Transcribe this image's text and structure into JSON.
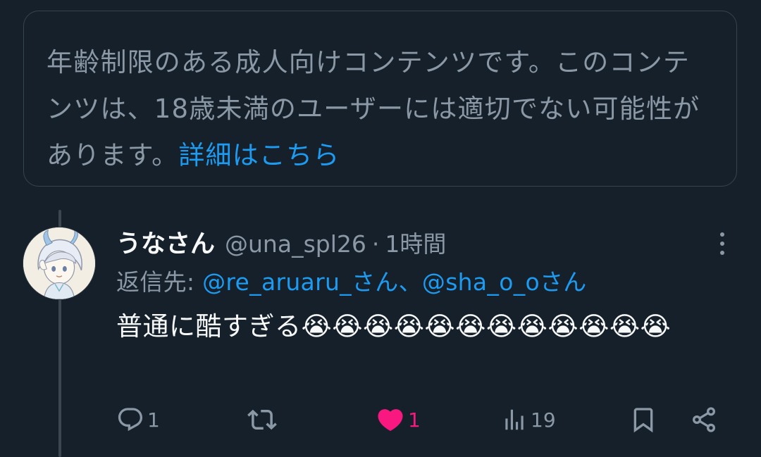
{
  "notice": {
    "text": "年齢制限のある成人向けコンテンツです。このコンテンツは、18歳未満のユーザーには適切でない可能性があります。",
    "link": "詳細はこちら"
  },
  "tweet": {
    "display_name": "うなさん",
    "handle": "@una_spl26",
    "separator": "·",
    "time": "1時間",
    "reply_prefix": "返信先: ",
    "mentions": [
      "@re_aruaru_さん",
      "@sha_o_oさん"
    ],
    "mention_separator": "、",
    "body": "普通に酷すぎる😭😭😭😭😭😭😭😭😭😭😭😭",
    "stats": {
      "replies": "1",
      "retweets": "",
      "likes": "1",
      "views": "19"
    }
  },
  "icons": {
    "reply": "speech-bubble-icon",
    "retweet": "retweet-arrows-icon",
    "like": "heart-filled-icon",
    "views": "bar-chart-icon",
    "bookmark": "bookmark-icon",
    "share": "share-nodes-icon",
    "more": "vertical-ellipsis-icon"
  },
  "colors": {
    "background": "#15202b",
    "text_primary": "#f7f9f9",
    "text_secondary": "#8b98a5",
    "link": "#1d9bf0",
    "like": "#f91880",
    "border": "#38444d"
  }
}
